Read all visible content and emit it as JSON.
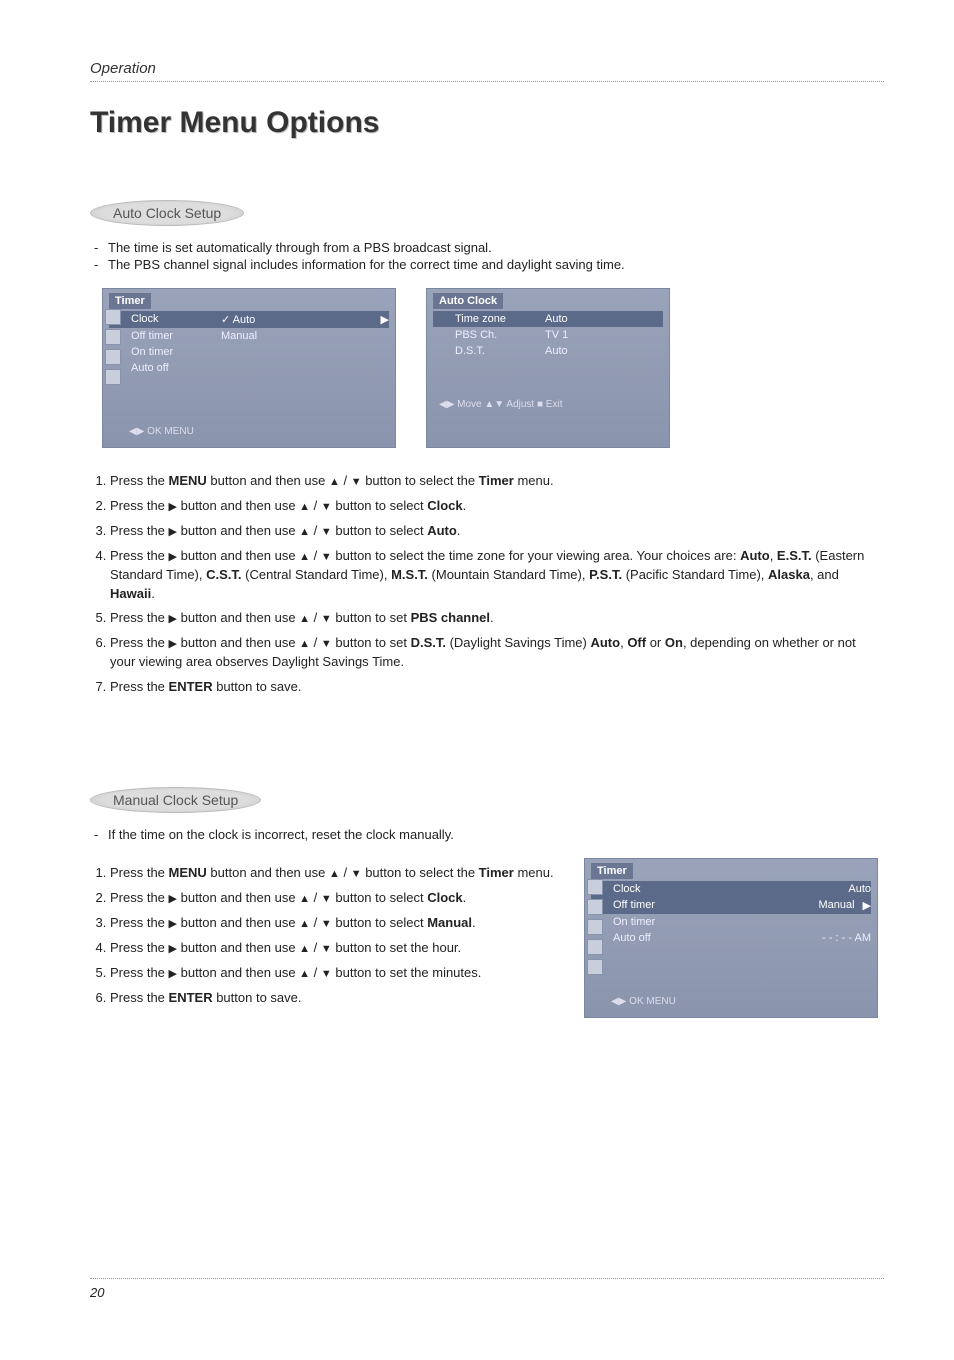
{
  "header": {
    "section": "Operation"
  },
  "title": "Timer Menu Options",
  "auto": {
    "heading": "Auto Clock Setup",
    "bullets": [
      "The time is set automatically through from a PBS broadcast signal.",
      "The PBS channel signal includes information for the correct time and daylight saving time."
    ],
    "osd1": {
      "title": "Timer",
      "rows": [
        {
          "k": "Clock",
          "v": "✓ Auto",
          "arrow": "▶",
          "hi": true
        },
        {
          "k": "Off timer",
          "v": "Manual"
        },
        {
          "k": "On timer",
          "v": ""
        },
        {
          "k": "Auto off",
          "v": ""
        }
      ],
      "hints": "◀▶ OK  MENU"
    },
    "osd2": {
      "title": "Auto Clock",
      "rows": [
        {
          "k": "Time zone",
          "v": "Auto",
          "hi": true
        },
        {
          "k": "PBS Ch.",
          "v": "TV 1"
        },
        {
          "k": "D.S.T.",
          "v": "Auto"
        }
      ],
      "hints": "◀▶ Move ▲▼ Adjust ■ Exit"
    },
    "steps": {
      "s1a": "Press the ",
      "s1_menu": "MENU",
      "s1b": " button and then use ",
      "s1c": " button to select the ",
      "s1_timer": "Timer",
      "s1d": " menu.",
      "s2a": "Press the ",
      "s2b": " button and then use ",
      "s2c": " button to select ",
      "s2_clock": "Clock",
      "s2d": ".",
      "s3a": "Press the ",
      "s3b": " button and then use ",
      "s3c": " button to select ",
      "s3_auto": "Auto",
      "s3d": ".",
      "s4a": "Press the ",
      "s4b": " button and then use ",
      "s4c": " button to select the time zone for your viewing area. Your choices are: ",
      "s4_list1": "Auto",
      "s4_list1b": ", ",
      "s4_list2": "E.S.T.",
      "s4_list2b": " (Eastern Standard Time), ",
      "s4_list3": "C.S.T.",
      "s4_list3b": " (Central Standard Time), ",
      "s4_list4": "M.S.T.",
      "s4_list4b": " (Mountain  Standard Time), ",
      "s4_list5": "P.S.T.",
      "s4_list5b": " (Pacific Standard Time), ",
      "s4_list6": "Alaska",
      "s4_list6b": ", and ",
      "s4_list7": "Hawaii",
      "s4_list7b": ".",
      "s5a": "Press the ",
      "s5b": " button and then use ",
      "s5c": " button to set ",
      "s5_pbs": "PBS channel",
      "s5d": ".",
      "s6a": "Press the ",
      "s6b": " button and then use ",
      "s6c": " button to set ",
      "s6_dst": "D.S.T.",
      "s6d": " (Daylight Savings Time) ",
      "s6_auto": "Auto",
      "s6e": ", ",
      "s6_off": "Off",
      "s6f": " or ",
      "s6_on": "On",
      "s6g": ", depending on whether or not your viewing area observes Daylight Savings Time.",
      "s7a": "Press the ",
      "s7_enter": "ENTER",
      "s7b": " button to save."
    }
  },
  "manual": {
    "heading": "Manual Clock Setup",
    "bullets": [
      "If the time on the clock is incorrect, reset the clock manually."
    ],
    "osd": {
      "title": "Timer",
      "rows": [
        {
          "k": "Clock",
          "v": "Auto",
          "hi": true
        },
        {
          "k": "Off timer",
          "v": "Manual",
          "arrow": "▶",
          "hi2": true
        },
        {
          "k": "On timer",
          "v": ""
        },
        {
          "k": "Auto off",
          "v": "- - : - -   AM"
        }
      ],
      "hints": "◀▶ OK  MENU"
    },
    "steps": {
      "s1a": "Press the ",
      "s1_menu": "MENU",
      "s1b": " button and then use ",
      "s1c": " button to select the ",
      "s1_timer": "Timer",
      "s1d": " menu.",
      "s2a": "Press the ",
      "s2b": " button and then use ",
      "s2c": " button to select ",
      "s2_clock": "Clock",
      "s2d": ".",
      "s3a": "Press the ",
      "s3b": " button and then use ",
      "s3c": " button to select ",
      "s3_manual": "Manual",
      "s3d": ".",
      "s4a": "Press the ",
      "s4b": " button and then use ",
      "s4c": " button to set the hour.",
      "s5a": "Press the ",
      "s5b": " button and then use ",
      "s5c": " button to set the minutes.",
      "s6a": "Press the ",
      "s6_enter": "ENTER",
      "s6b": " button to save."
    }
  },
  "footer": {
    "page": "20"
  }
}
